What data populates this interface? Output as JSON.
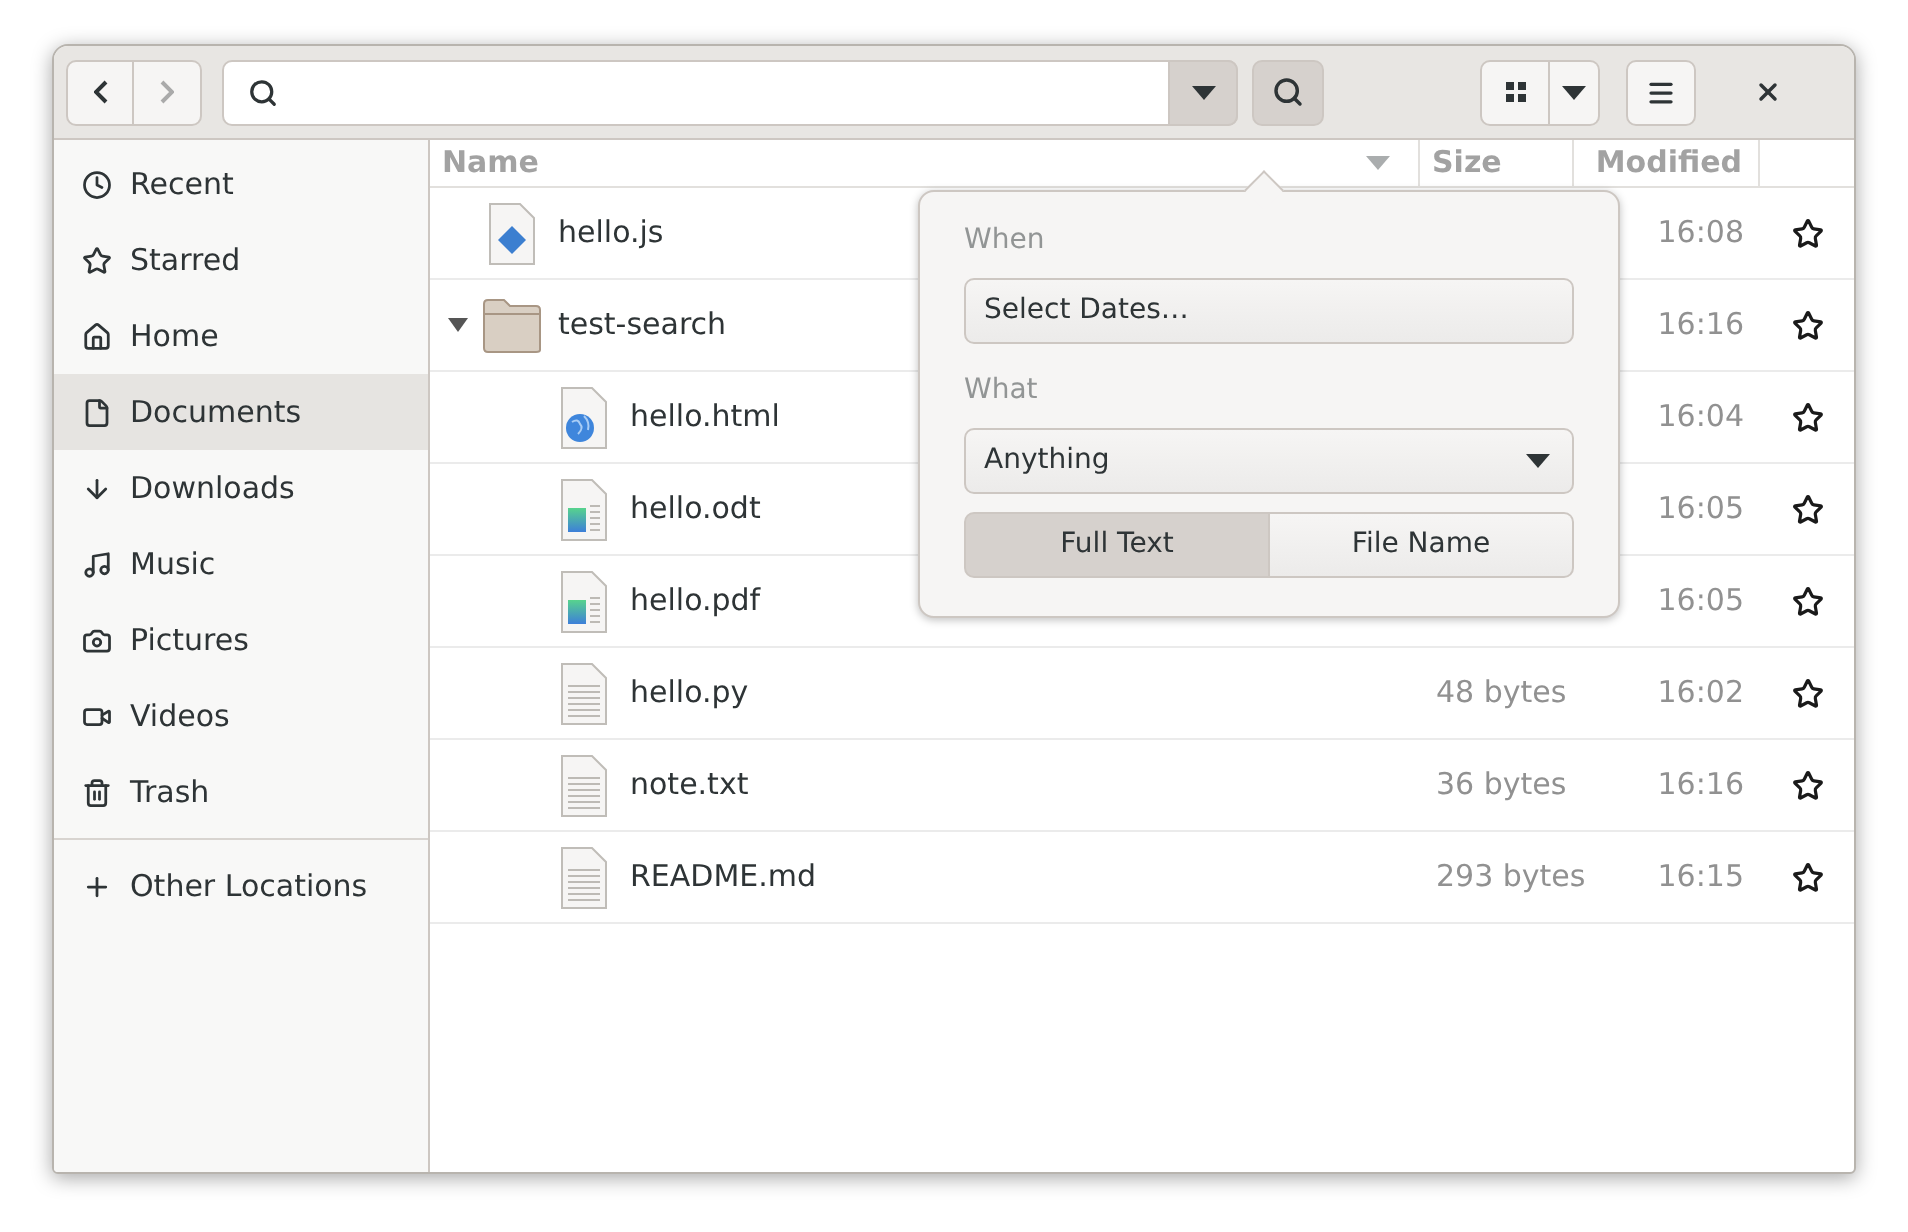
{
  "toolbar": {
    "back_disabled": false,
    "forward_disabled": true
  },
  "sidebar": {
    "items": [
      {
        "label": "Recent",
        "selected": false
      },
      {
        "label": "Starred",
        "selected": false
      },
      {
        "label": "Home",
        "selected": false
      },
      {
        "label": "Documents",
        "selected": true
      },
      {
        "label": "Downloads",
        "selected": false
      },
      {
        "label": "Music",
        "selected": false
      },
      {
        "label": "Pictures",
        "selected": false
      },
      {
        "label": "Videos",
        "selected": false
      },
      {
        "label": "Trash",
        "selected": false
      }
    ],
    "other_locations": "Other Locations"
  },
  "table": {
    "columns": [
      "Name",
      "Size",
      "Modified"
    ],
    "rows": [
      {
        "kind": "script",
        "name": "hello.js",
        "modified": "16:08",
        "starred": false
      },
      {
        "kind": "folder",
        "name": "test-search",
        "modified": "16:16",
        "starred": false,
        "expanded": true,
        "children": [
          {
            "kind": "web",
            "name": "hello.html",
            "modified": "16:04",
            "starred": false
          },
          {
            "kind": "document",
            "name": "hello.odt",
            "modified": "16:05",
            "starred": false
          },
          {
            "kind": "document",
            "name": "hello.pdf",
            "modified": "16:05",
            "starred": false
          },
          {
            "kind": "text",
            "name": "hello.py",
            "size": "48 bytes",
            "modified": "16:02",
            "starred": false
          },
          {
            "kind": "text",
            "name": "note.txt",
            "size": "36 bytes",
            "modified": "16:16",
            "starred": false
          },
          {
            "kind": "text",
            "name": "README.md",
            "size": "293 bytes",
            "modified": "16:15",
            "starred": false
          }
        ]
      }
    ]
  },
  "search_popover": {
    "when_label": "When",
    "dates_button": "Select Dates…",
    "what_label": "What",
    "what_value": "Anything",
    "modes": [
      {
        "label": "Full Text",
        "selected": true
      },
      {
        "label": "File Name",
        "selected": false
      }
    ]
  }
}
